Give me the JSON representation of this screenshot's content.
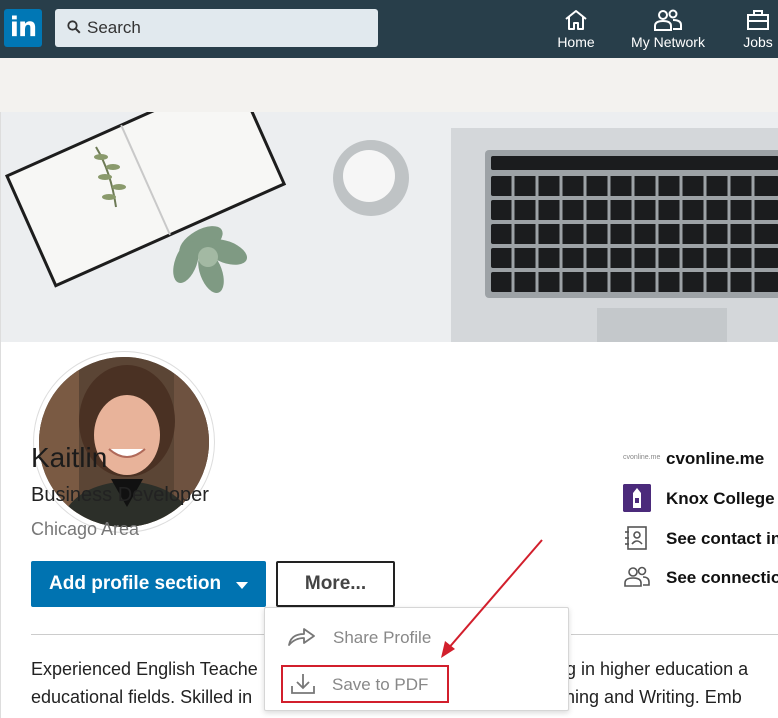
{
  "topbar": {
    "logo": "in",
    "search_placeholder": "Search",
    "nav": [
      {
        "label": "Home",
        "icon": "home-icon"
      },
      {
        "label": "My Network",
        "icon": "network-icon"
      },
      {
        "label": "Jobs",
        "icon": "briefcase-icon"
      }
    ]
  },
  "profile": {
    "name": "Kaitlin",
    "headline": "Business Developer",
    "location": "Chicago Area",
    "add_section_label": "Add profile section",
    "more_label": "More...",
    "about_line1_a": "Experienced English Teache",
    "about_line1_b": "king in higher education a",
    "about_line2_a": "educational fields. Skilled in",
    "about_line2_b": "lanning and Writing. Emb"
  },
  "sidebar": {
    "items": [
      {
        "label": "cvonline.me",
        "logo_text": "cvonline.me"
      },
      {
        "label": "Knox College"
      },
      {
        "label": "See contact in"
      },
      {
        "label": "See connectio"
      }
    ]
  },
  "dropdown": {
    "items": [
      {
        "label": "Share Profile",
        "icon": "share-icon"
      },
      {
        "label": "Save to PDF",
        "icon": "download-icon"
      }
    ]
  },
  "colors": {
    "nav_bg": "#283e4a",
    "brand_blue": "#0073b1",
    "highlight_red": "#d21f2c"
  }
}
